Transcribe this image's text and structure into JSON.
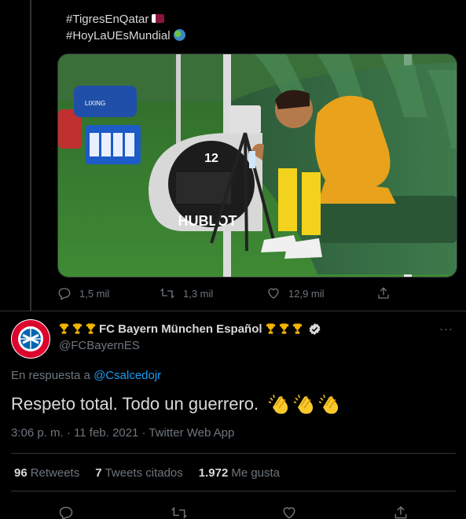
{
  "parent": {
    "hashtag1": "#TigresEnQatar",
    "hashtag2": "#HoyLaUEsMundial",
    "photo_watch_number": "12",
    "photo_brand": "HUBLOT",
    "photo_box_text": "LIXING",
    "actions": {
      "replies": "1,5 mil",
      "retweets": "1,3 mil",
      "likes": "12,9 mil"
    }
  },
  "reply": {
    "display_name": "FC Bayern München Español",
    "handle": "@FCBayernES",
    "in_reply_prefix": "En respuesta a",
    "in_reply_mention": "@Csalcedojr",
    "text": "Respeto total. Todo un guerrero.",
    "timestamp": "3:06 p. m. · 11 feb. 2021 · Twitter Web App",
    "stats": {
      "retweets_count": "96",
      "retweets_label": "Retweets",
      "quotes_count": "7",
      "quotes_label": "Tweets citados",
      "likes_count": "1.972",
      "likes_label": "Me gusta"
    },
    "more_label": "···"
  },
  "colors": {
    "background": "#000000",
    "text": "#d9d9d9",
    "secondary": "#6e767d",
    "link": "#1d9bf0",
    "border": "#2f3336"
  },
  "icons": [
    "reply-icon",
    "retweet-icon",
    "like-icon",
    "share-icon",
    "more-icon",
    "verified-icon",
    "trophy-icon",
    "clap-icon",
    "flag-icon",
    "globe-icon"
  ]
}
